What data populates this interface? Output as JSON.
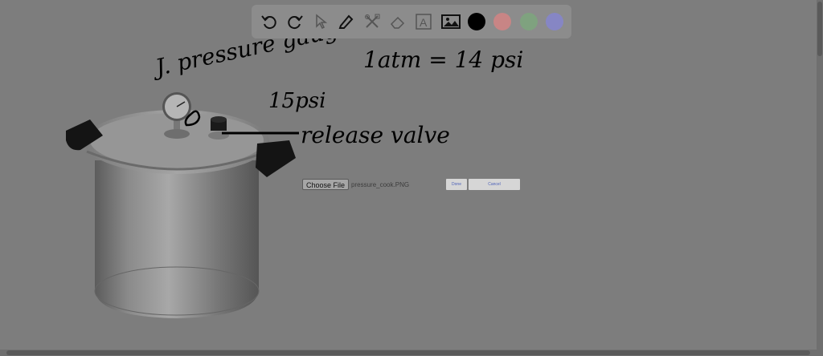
{
  "toolbar": {
    "tools": [
      "undo-icon",
      "redo-icon",
      "select-icon",
      "pen-icon",
      "tools-icon",
      "eraser-icon",
      "text-icon",
      "image-icon"
    ],
    "colors": [
      "#000000",
      "#c88585",
      "#7fa27f",
      "#8686c4"
    ]
  },
  "annotations": {
    "pressure_gauge": "J. pressure gauge",
    "gauge_value": "15psi",
    "atm_equation": "1atm = 14 psi",
    "release_valve": "release valve"
  },
  "upload": {
    "choose_label": "Choose File",
    "filename": "pressure_cook.PNG",
    "done_label": "Done",
    "cancel_label": "Cancel"
  }
}
